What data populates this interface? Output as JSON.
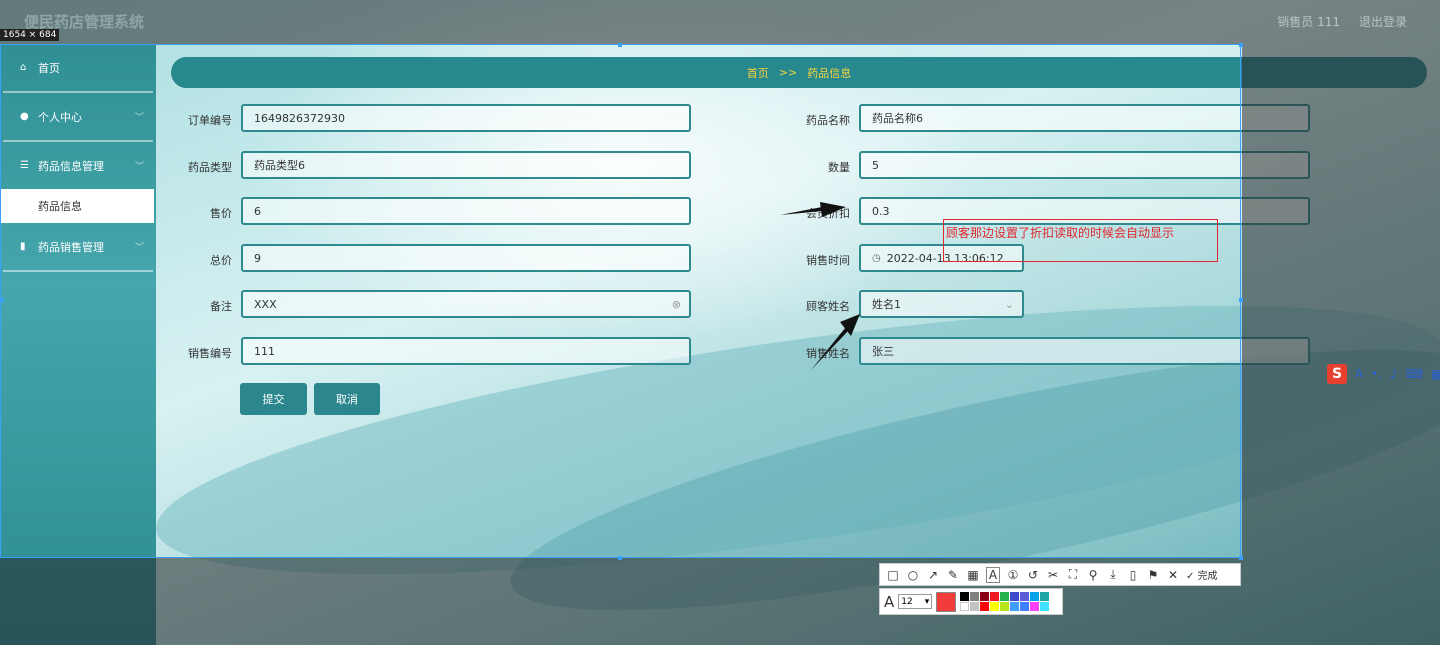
{
  "header": {
    "app_title": "便民药店管理系统",
    "user": "销售员 111",
    "logout": "退出登录",
    "screen_size": "1654 × 684"
  },
  "sidebar": {
    "items": [
      {
        "label": "首页",
        "icon": "home-icon"
      },
      {
        "label": "个人中心",
        "icon": "user-icon"
      },
      {
        "label": "药品信息管理",
        "icon": "list-icon"
      },
      {
        "label": "药品信息",
        "icon": ""
      },
      {
        "label": "药品销售管理",
        "icon": "chart-icon"
      }
    ]
  },
  "breadcrumb": {
    "home": "首页",
    "separator": ">>",
    "current": "药品信息"
  },
  "form": {
    "order_no": {
      "label": "订单编号",
      "value": "1649826372930"
    },
    "drug_name": {
      "label": "药品名称",
      "value": "药品名称6"
    },
    "drug_type": {
      "label": "药品类型",
      "value": "药品类型6"
    },
    "quantity": {
      "label": "数量",
      "value": "5"
    },
    "price": {
      "label": "售价",
      "value": "6"
    },
    "member_discount": {
      "label": "会员折扣",
      "value": "0.3"
    },
    "total": {
      "label": "总价",
      "value": "9"
    },
    "sale_time": {
      "label": "销售时间",
      "value": "2022-04-13 13:06:12"
    },
    "remark": {
      "label": "备注",
      "value": "XXX"
    },
    "customer_name": {
      "label": "顾客姓名",
      "value": "姓名1"
    },
    "sale_no": {
      "label": "销售编号",
      "value": "111"
    },
    "seller_name": {
      "label": "销售姓名",
      "value": "张三"
    },
    "submit": "提交",
    "cancel": "取消"
  },
  "annotation": {
    "text": "顾客那边设置了折扣读取的时候会自动显示",
    "color": "#e0282e"
  },
  "toolbar": {
    "done": "完成",
    "font_size": "12",
    "current_color": "#f23b3b",
    "palette": [
      "#000000",
      "#7f7f7f",
      "#880015",
      "#ed1c24",
      "#22b14c",
      "#3f48cc",
      "#5b5bd6",
      "#00a2e8",
      "#1fa4a4",
      "#ffffff",
      "#c3c3c3",
      "#ff0000",
      "#ffff00",
      "#b5e61d",
      "#3f9fff",
      "#4080ff",
      "#ff40ff",
      "#40e0ff"
    ]
  },
  "ime": {
    "logo": "S",
    "mode": "A"
  }
}
